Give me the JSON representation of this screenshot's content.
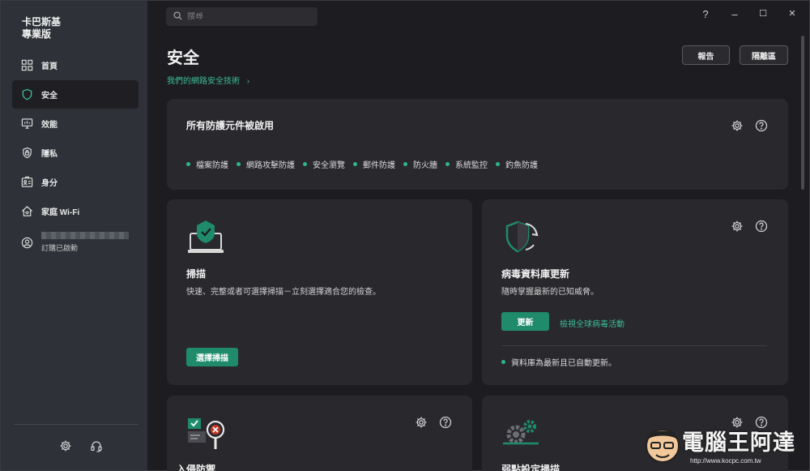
{
  "app": {
    "brand_line1": "卡巴斯基",
    "brand_line2": "專業版"
  },
  "sidebar": {
    "items": [
      {
        "label": "首頁",
        "icon": "home-grid-icon"
      },
      {
        "label": "安全",
        "icon": "shield-icon",
        "active": true
      },
      {
        "label": "效能",
        "icon": "monitor-icon"
      },
      {
        "label": "隱私",
        "icon": "privacy-lock-icon"
      },
      {
        "label": "身分",
        "icon": "id-card-icon"
      },
      {
        "label": "家庭 Wi-Fi",
        "icon": "home-wifi-icon"
      }
    ],
    "account": {
      "status": "訂購已啟動",
      "icon": "user-icon"
    },
    "footer": {
      "settings_icon": "gear-icon",
      "support_icon": "headset-icon"
    }
  },
  "search": {
    "placeholder": "搜尋"
  },
  "window": {
    "help": "?",
    "minimize": "–",
    "maximize": "☐",
    "close": "✕"
  },
  "header": {
    "title": "安全",
    "tech_link": "我們的網路安全技術",
    "report_button": "報告",
    "quarantine_button": "隔離區"
  },
  "protection_card": {
    "title": "所有防護元件被啟用",
    "components": [
      "檔案防護",
      "網路攻擊防護",
      "安全瀏覽",
      "郵件防護",
      "防火牆",
      "系統監控",
      "釣魚防護"
    ]
  },
  "scan_card": {
    "title": "掃描",
    "desc": "快速、完整或者可選擇掃描－立刻選擇適合您的檢查。",
    "button": "選擇掃描"
  },
  "update_card": {
    "title": "病毒資料庫更新",
    "desc": "隨時掌握最新的已知威脅。",
    "button": "更新",
    "link": "檢視全球病毒活動",
    "status": "資料庫為最新且已自動更新。"
  },
  "bottom_left_card": {
    "title": "入侵防禦"
  },
  "bottom_right_card": {
    "title": "弱點設定掃描"
  },
  "watermark": {
    "text": "電腦王阿達",
    "url": "http://www.kocpc.com.tw"
  },
  "colors": {
    "accent": "#1f8b6a",
    "dot": "#2fb68a",
    "link": "#3dbb94",
    "sidebar": "#2e3238"
  }
}
